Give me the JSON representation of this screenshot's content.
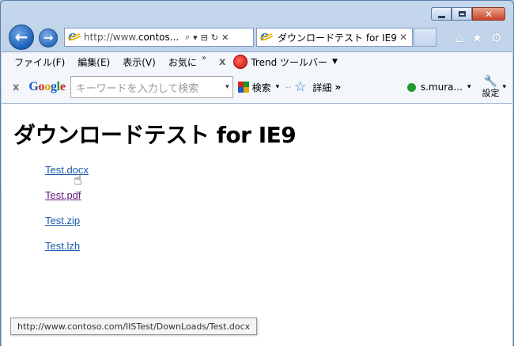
{
  "window": {
    "minimize_icon": "minimize-icon",
    "maximize_icon": "maximize-icon",
    "close_glyph": "✕"
  },
  "nav": {
    "back_glyph": "←",
    "forward_glyph": "→",
    "address_prefix": "http://www.",
    "address_domain": "contos...",
    "search_glyph": "⌕",
    "dropdown_glyph": "▾",
    "compat_glyph": "⊟",
    "refresh_glyph": "↻",
    "stop_glyph": "✕"
  },
  "tab": {
    "title": "ダウンロードテスト for IE9",
    "close_glyph": "✕"
  },
  "toolbar_icons": {
    "home": "⌂",
    "favorites": "★",
    "tools": "⚙"
  },
  "menu": {
    "items": [
      "ファイル(F)",
      "編集(E)",
      "表示(V)",
      "お気に"
    ],
    "more_glyph": "»",
    "close_glyph": "x",
    "trend_label": "Trend ツールバー",
    "trend_dropdown": "▼"
  },
  "google_bar": {
    "close_glyph": "x",
    "logo": [
      "G",
      "o",
      "o",
      "g",
      "l",
      "e"
    ],
    "search_placeholder": "キーワードを入力して検索",
    "dropdown_glyph": "▾",
    "search_label": "検索",
    "search_dropdown": "▾",
    "sep_glyph": "··",
    "detail_label": "詳細",
    "more_glyph": "»",
    "user_label": "s.mura...",
    "user_dropdown": "▾",
    "settings_glyph": "🔧",
    "settings_label": "設定",
    "settings_dropdown": "▾"
  },
  "page": {
    "title": "ダウンロードテスト for IE9",
    "links": [
      {
        "label": "Test.docx",
        "visited": false
      },
      {
        "label": "Test.pdf",
        "visited": true
      },
      {
        "label": "Test.zip",
        "visited": false
      },
      {
        "label": "Test.lzh",
        "visited": false
      }
    ]
  },
  "status": {
    "url": "http://www.contoso.com/IISTest/DownLoads/Test.docx"
  },
  "colors": {
    "link": "#1a58a8",
    "visited": "#6a1b80",
    "accent": "#1b5fb5"
  }
}
